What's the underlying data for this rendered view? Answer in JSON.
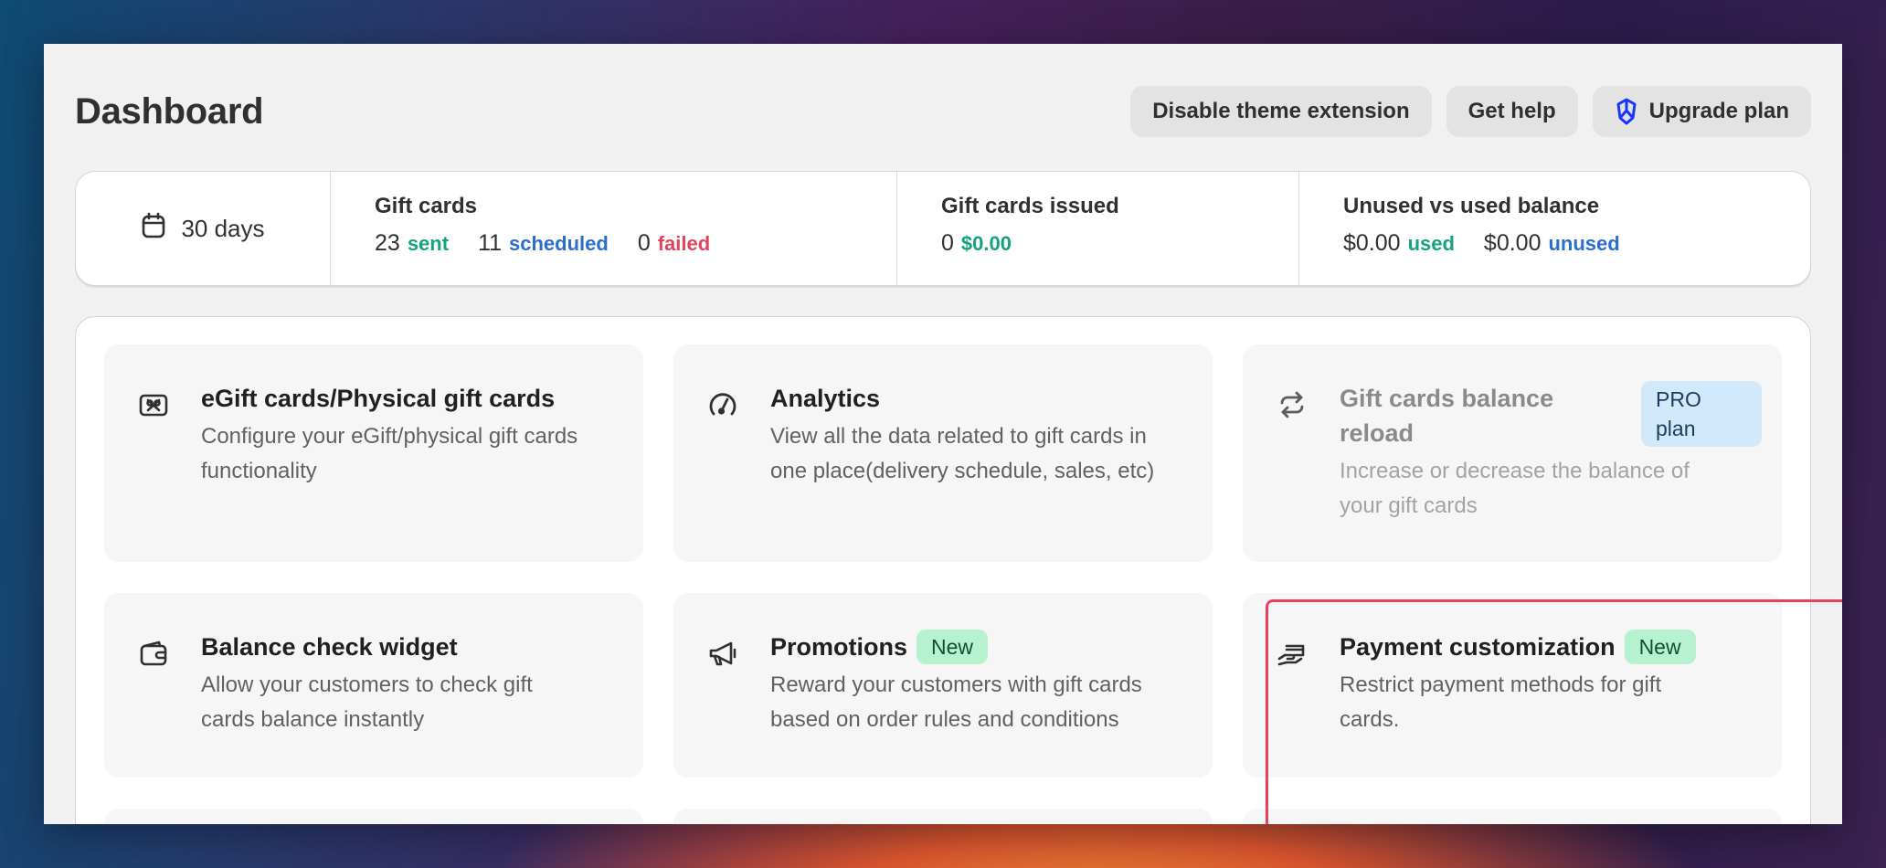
{
  "header": {
    "title": "Dashboard",
    "actions": {
      "disable_theme": "Disable theme extension",
      "get_help": "Get help",
      "upgrade": "Upgrade plan"
    }
  },
  "stats": {
    "range": "30 days",
    "gift_cards": {
      "label": "Gift cards",
      "sent_count": "23",
      "sent_label": "sent",
      "scheduled_count": "11",
      "scheduled_label": "scheduled",
      "failed_count": "0",
      "failed_label": "failed"
    },
    "issued": {
      "label": "Gift cards issued",
      "count": "0",
      "amount": "$0.00"
    },
    "balance": {
      "label": "Unused vs used balance",
      "used_amount": "$0.00",
      "used_label": "used",
      "unused_amount": "$0.00",
      "unused_label": "unused"
    }
  },
  "cards": [
    {
      "icon": "gift-card-icon",
      "title": "eGift cards/Physical gift cards",
      "description_lines": [
        "Configure your eGift/physical gift cards",
        "functionality"
      ]
    },
    {
      "icon": "gauge-icon",
      "title": "Analytics",
      "description_lines": [
        "View all the data related to gift cards in",
        "one place(delivery schedule, sales, etc)"
      ]
    },
    {
      "icon": "refresh-icon",
      "title_lines": [
        "Gift cards balance",
        "reload"
      ],
      "badge_lines": [
        "PRO",
        "plan"
      ],
      "description_lines": [
        "Increase or decrease the balance of",
        "your gift cards"
      ],
      "disabled": true
    },
    {
      "icon": "wallet-icon",
      "title": "Balance check widget",
      "description_lines": [
        "Allow your customers to check gift",
        "cards balance instantly"
      ]
    },
    {
      "icon": "megaphone-icon",
      "title": "Promotions",
      "badge": "New",
      "description_lines": [
        "Reward your customers with gift cards",
        "based on order rules and conditions"
      ]
    },
    {
      "icon": "hand-card-icon",
      "title": "Payment customization",
      "badge": "New",
      "description_lines": [
        "Restrict payment methods for gift",
        "cards."
      ]
    }
  ],
  "colors": {
    "sent": "#14a37f",
    "scheduled": "#2c6ecb",
    "failed": "#e0445e",
    "highlight": "#e8415f",
    "new_badge": "#b6f2cf",
    "pro_badge": "#d2e8fb"
  }
}
